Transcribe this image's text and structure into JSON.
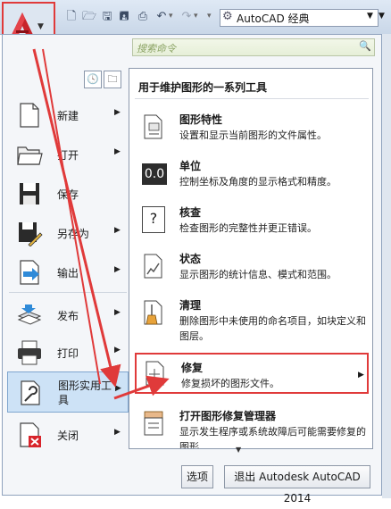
{
  "qat": {
    "workspace": "AutoCAD 经典"
  },
  "search": {
    "placeholder": "搜索命令"
  },
  "left_menu": [
    {
      "key": "new",
      "label": "新建",
      "has_arrow": true
    },
    {
      "key": "open",
      "label": "打开",
      "has_arrow": true
    },
    {
      "key": "save",
      "label": "保存",
      "has_arrow": false
    },
    {
      "key": "saveas",
      "label": "另存为",
      "has_arrow": true
    },
    {
      "key": "export",
      "label": "输出",
      "has_arrow": true
    },
    {
      "key": "publish",
      "label": "发布",
      "has_arrow": true
    },
    {
      "key": "print",
      "label": "打印",
      "has_arrow": true
    },
    {
      "key": "util",
      "label": "图形实用工具",
      "label_line1": "图形实用工",
      "label_line2": "具",
      "has_arrow": true
    },
    {
      "key": "close",
      "label": "关闭",
      "has_arrow": true
    }
  ],
  "submenu": {
    "title": "用于维护图形的一系列工具",
    "items": [
      {
        "key": "props",
        "title": "图形特性",
        "desc": "设置和显示当前图形的文件属性。"
      },
      {
        "key": "units",
        "title": "单位",
        "desc": "控制坐标及角度的显示格式和精度。",
        "icon_text": "0.0"
      },
      {
        "key": "audit",
        "title": "核查",
        "desc": "检查图形的完整性并更正错误。",
        "icon_text": "?"
      },
      {
        "key": "status",
        "title": "状态",
        "desc": "显示图形的统计信息、模式和范围。"
      },
      {
        "key": "purge",
        "title": "清理",
        "desc": "删除图形中未使用的命名项目，如块定义和图层。"
      },
      {
        "key": "repair",
        "title": "修复",
        "desc": "修复损坏的图形文件。"
      },
      {
        "key": "recover",
        "title": "打开图形修复管理器",
        "desc": "显示发生程序或系统故障后可能需要修复的图形"
      }
    ]
  },
  "bottom": {
    "options": "选项",
    "exit": "退出 Autodesk AutoCAD 2014"
  },
  "colors": {
    "highlight_red": "#e03a3a",
    "app_red": "#c8242b",
    "selected_blue": "#cde2f6"
  }
}
